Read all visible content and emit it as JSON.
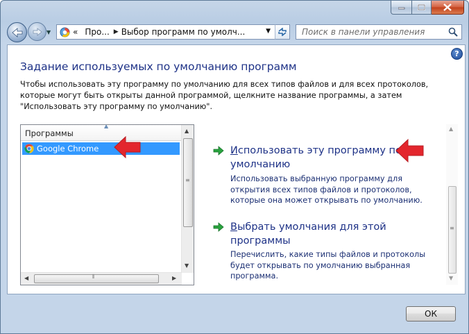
{
  "window": {
    "minimize_label": "",
    "maximize_label": "",
    "close_label": ""
  },
  "nav": {
    "breadcrumb_overflow": "«",
    "breadcrumb_1": "Про...",
    "breadcrumb_2": "Выбор программ по умолч...",
    "search_placeholder": "Поиск в панели управления"
  },
  "content": {
    "help": "?",
    "heading": "Задание используемых по умолчанию программ",
    "description": "Чтобы использовать эту программу по умолчанию для всех типов файлов и для всех протоколов, которые могут быть открыты данной программой, щелкните название программы, а затем \"Использовать эту программу по умолчанию\"."
  },
  "programs": {
    "header": "Программы",
    "items": [
      {
        "label": "Google Chrome",
        "selected": true
      }
    ]
  },
  "actions": [
    {
      "accel": "И",
      "title_rest": "спользовать эту программу по умолчанию",
      "description": "Использовать выбранную программу для открытия всех типов файлов и протоколов, которые она может открывать по умолчанию."
    },
    {
      "accel": "В",
      "title_rest": "ыбрать умолчания для этой программы",
      "description": "Перечислить, какие типы файлов и протоколы будет открывать по умолчанию выбранная программа."
    }
  ],
  "footer": {
    "ok_label": "ОК"
  },
  "colors": {
    "link": "#1e3287",
    "selection": "#3399ff",
    "annotation_arrow": "#e3262d"
  }
}
